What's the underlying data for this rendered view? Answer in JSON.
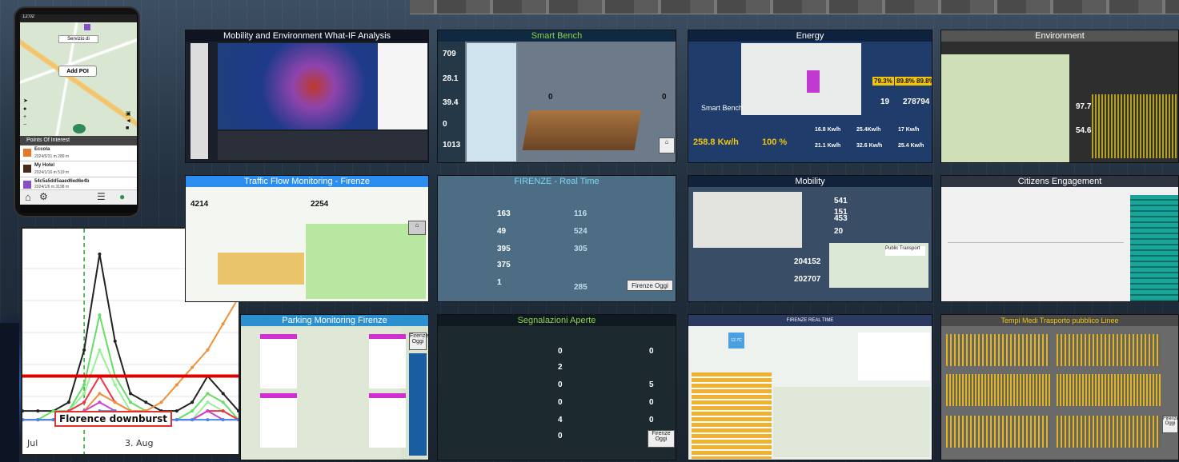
{
  "phone": {
    "status_time": "12:02",
    "map_label": "Servizio di",
    "add_poi_label": "Add POI",
    "poi_header": "Points Of Interest",
    "items": [
      {
        "title": "Eccola",
        "meta": "2024/5/31 m  289 m"
      },
      {
        "title": "My Hotel",
        "meta": "2024/1/16 m  519 m"
      },
      {
        "title": "54c5a5dd5aaed6ed6e4b",
        "meta": "2024/1/6 m  3198 m"
      }
    ]
  },
  "chart": {
    "annotation": "Florence downburst",
    "x_ticks": [
      "Jul",
      "3. Aug"
    ],
    "event_line_color": "#2ca02c",
    "threshold_color": "#e00000"
  },
  "chart_data": {
    "type": "line",
    "x": [
      0,
      1,
      2,
      3,
      4,
      5,
      6,
      7,
      8,
      9,
      10,
      11,
      12,
      13,
      14
    ],
    "series": [
      {
        "values": [
          2,
          2,
          2,
          3,
          9,
          20,
          10,
          4,
          3,
          2,
          2,
          3,
          6,
          4,
          2
        ],
        "color": "#222222"
      },
      {
        "values": [
          1,
          1,
          2,
          2,
          5,
          13,
          6,
          3,
          2,
          1,
          1,
          2,
          4,
          3,
          1
        ],
        "color": "#66dd66"
      },
      {
        "values": [
          1,
          1,
          1,
          2,
          4,
          9,
          5,
          2,
          2,
          1,
          1,
          1,
          3,
          2,
          1
        ],
        "color": "#99ee99"
      },
      {
        "values": [
          1,
          1,
          1,
          2,
          3,
          6,
          3,
          2,
          1,
          1,
          1,
          1,
          2,
          2,
          1
        ],
        "color": "#ee3344"
      },
      {
        "values": [
          1,
          1,
          1,
          1,
          2,
          4,
          3,
          2,
          2,
          3,
          5,
          7,
          9,
          12,
          15
        ],
        "color": "#f0913a"
      },
      {
        "values": [
          1,
          1,
          1,
          1,
          2,
          3,
          2,
          1,
          1,
          1,
          1,
          1,
          2,
          1,
          1
        ],
        "color": "#cc44cc"
      },
      {
        "values": [
          1,
          1,
          1,
          1,
          1,
          2,
          2,
          1,
          1,
          1,
          1,
          1,
          1,
          1,
          1
        ],
        "color": "#4488ee"
      }
    ],
    "threshold": 6,
    "event_x": 4,
    "ylim": [
      0,
      22
    ]
  },
  "tiles": {
    "mobility_env": {
      "title": "Mobility and Environment What-IF Analysis"
    },
    "smart_bench": {
      "title": "Smart Bench",
      "values": [
        "709",
        "28.1",
        "39.4",
        "0",
        "1013"
      ],
      "side_values": [
        "0",
        "0"
      ]
    },
    "energy": {
      "title": "Energy",
      "kpis": [
        "19",
        "278794"
      ],
      "pct": [
        "79.3%",
        "89.8%",
        "89.8%"
      ],
      "flows": [
        "16.8 Kw/h",
        "25.4Kw/h",
        "17 Kw/h",
        "21.1 Kw/h",
        "32.6 Kw/h",
        "25.4 Kw/h"
      ],
      "big": "258.8 Kw/h",
      "pct_big": "100 %",
      "bench_label": "Smart Bench"
    },
    "environment": {
      "title": "Environment",
      "values": [
        "97.7",
        "54.6"
      ]
    },
    "traffic": {
      "title": "Traffic Flow Monitoring - Firenze",
      "values": [
        "4214",
        "2254"
      ]
    },
    "realtime": {
      "title": "FIRENZE - Real Time",
      "values": [
        "163",
        "49",
        "395",
        "375",
        "1"
      ],
      "right_values": [
        "116",
        "524",
        "305",
        "285"
      ],
      "button": "Firenze Oggi"
    },
    "mobility": {
      "title": "Mobility",
      "values": [
        "541",
        "151",
        "453",
        "20",
        "204152",
        "202707"
      ],
      "popup": "Public Transport"
    },
    "citizens": {
      "title": "Citizens Engagement"
    },
    "parking": {
      "title": "Parking Monitoring Firenze",
      "button": "Firenze Oggi"
    },
    "segnalazioni": {
      "title": "Segnalazioni Aperte",
      "values": [
        "0",
        "2",
        "0",
        "0",
        "4",
        "0"
      ],
      "right_values": [
        "0",
        "5",
        "0",
        "0"
      ],
      "button": "Firenze Oggi"
    },
    "multi": {
      "title": "FIRENZE REAL TIME",
      "temp": "12.7C"
    },
    "tempi": {
      "title": "Tempi Medi Trasporto pubblico Linee",
      "button": "Firenze Oggi"
    }
  }
}
